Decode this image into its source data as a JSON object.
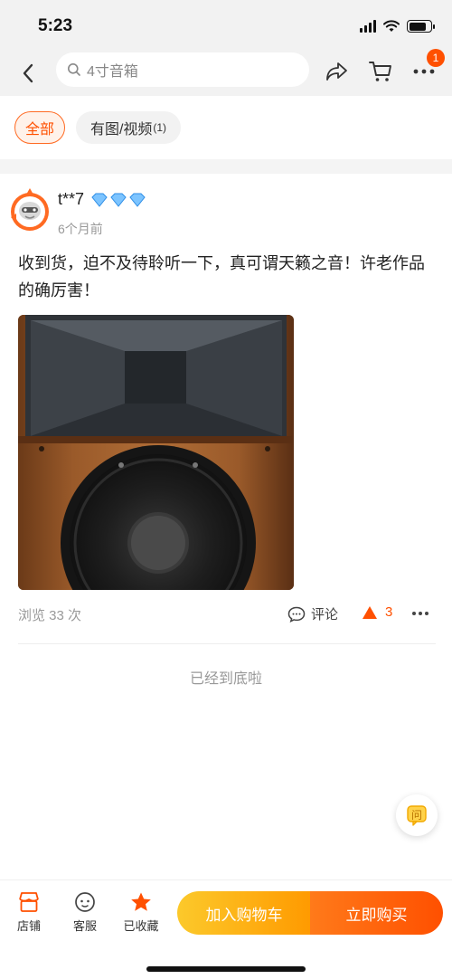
{
  "status_bar": {
    "time": "5:23"
  },
  "nav": {
    "search_placeholder": "4寸音箱",
    "more_badge": "1"
  },
  "filters": {
    "all": "全部",
    "with_media": "有图/视频",
    "with_media_count": "(1)"
  },
  "review": {
    "username": "t**7",
    "time_ago": "6个月前",
    "text": "收到货，迫不及待聆听一下，真可谓天籁之音！许老作品的确厉害！",
    "views": "浏览 33 次",
    "comment_label": "评论",
    "likes": "3"
  },
  "feed_end_text": "已经到底啦",
  "float_button": {
    "label": "问"
  },
  "bottom_bar": {
    "shop": "店铺",
    "service": "客服",
    "favorited": "已收藏",
    "add_to_cart": "加入购物车",
    "buy_now": "立即购买"
  },
  "colors": {
    "accent": "#ff5000",
    "cart_gradient_start": "#fcc92b",
    "buy_gradient_end": "#ff5000",
    "diamond": "#4aa8ff"
  }
}
